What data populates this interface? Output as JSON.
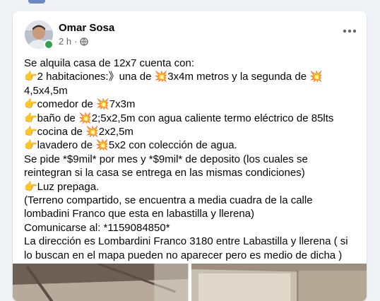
{
  "post": {
    "author": "Omar Sosa",
    "time": "2 h",
    "separator": "·",
    "lines": [
      "Se alquila casa de 12x7 cuenta con:",
      "👉2 habitaciones:》una de 💥3x4m metros y la segunda de 💥",
      "4,5x4,5m",
      "👉comedor de 💥7x3m",
      "👉baño de 💥2;5x2,5m con agua caliente termo eléctrico de 85lts",
      "👉cocina de 💥2x2,5m",
      "👉lavadero de 💥5x2 con colección de agua.",
      "Se pide *$9mil* por mes y *$9mil* de deposito (los cuales se",
      "reintegran si la casa se entrega en las mismas condiciones)",
      "👉Luz prepaga.",
      "(Terreno compartido, se encuentra a media cuadra de la calle",
      "lombadini Franco que esta en labastilla y llerena)",
      "Comunicarse al: *1159084850*",
      "La dirección es Lombardini Franco 3180 entre Labastilla y llerena ( si",
      "lo buscan en el mapa pueden no aparecer pero es medio de dicha )"
    ]
  },
  "icons": {
    "privacy": "globe-icon",
    "menu": "more-options-icon"
  },
  "colors": {
    "background": "#f0f2f5",
    "card": "#ffffff",
    "online": "#31a24c",
    "secondary_text": "#65676b"
  }
}
